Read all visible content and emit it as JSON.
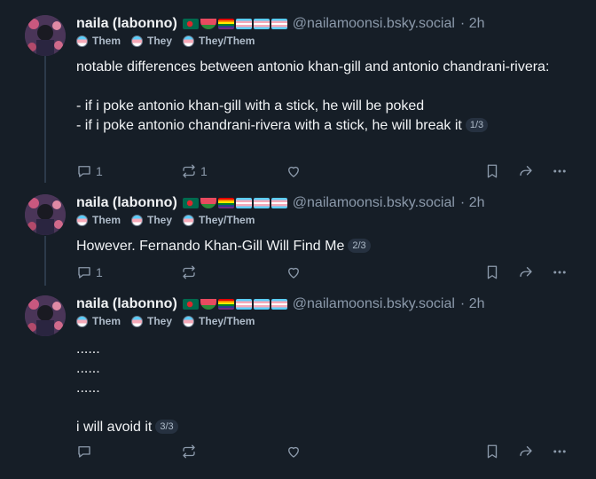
{
  "author": {
    "name": "naila (labonno)",
    "handle": "@nailamoonsi.bsky.social",
    "time": "· 2h",
    "pronouns": [
      "Them",
      "They",
      "They/Them"
    ],
    "flag_colors": [
      "#006a4e",
      "#e84a5f",
      "#e40303",
      "#5bcefa",
      "#5bcefa",
      "#5bcefa"
    ]
  },
  "posts": [
    {
      "text": "notable differences between antonio khan-gill and antonio chandrani-rivera:\n\n- if i poke antonio khan-gill with a stick, he will be poked\n- if i poke antonio chandrani-rivera with a stick, he will break it",
      "badge": "1/3",
      "reply_count": "1",
      "repost_count": "1"
    },
    {
      "text": "However. Fernando Khan-Gill Will Find Me",
      "badge": "2/3",
      "reply_count": "1",
      "repost_count": ""
    },
    {
      "text": "......\n......\n......\n\ni will avoid it",
      "badge": "3/3",
      "reply_count": "",
      "repost_count": ""
    }
  ]
}
